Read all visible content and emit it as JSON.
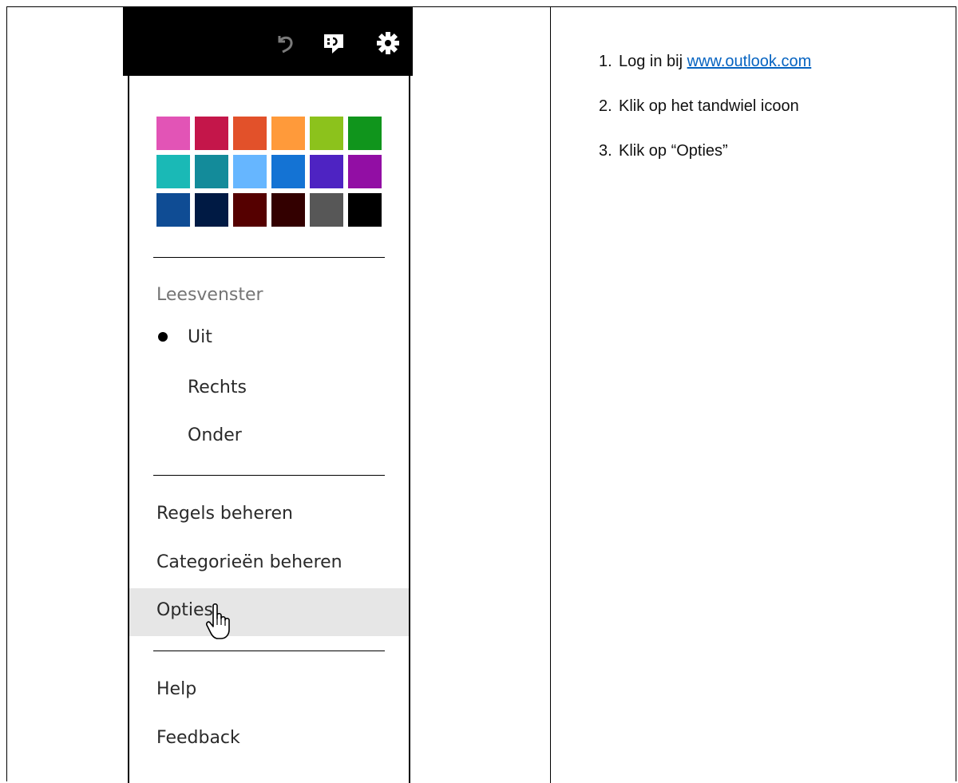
{
  "toolbar": {
    "icons": [
      "undo-icon",
      "feedback-chat-icon",
      "gear-icon"
    ]
  },
  "theme": {
    "colors": [
      "#e254b6",
      "#c4164a",
      "#e2512a",
      "#ff9a3a",
      "#8cc21c",
      "#10951c",
      "#1ab9b6",
      "#138b9a",
      "#66b6ff",
      "#1473d4",
      "#4e23c2",
      "#920ea4",
      "#0f4c94",
      "#001a44",
      "#550000",
      "#330000",
      "#575757",
      "#000000"
    ]
  },
  "menu": {
    "reading_pane_label": "Leesvenster",
    "reading_pane_options": [
      {
        "label": "Uit",
        "selected": true
      },
      {
        "label": "Rechts",
        "selected": false
      },
      {
        "label": "Onder",
        "selected": false
      }
    ],
    "manage_rules": "Regels beheren",
    "manage_categories": "Categorieën beheren",
    "options": "Opties",
    "help": "Help",
    "feedback": "Feedback"
  },
  "instructions": {
    "step1_number": "1.",
    "step1_prefix": "Log in bij ",
    "step1_link": "www.outlook.com",
    "step2_number": "2.",
    "step2_text": "Klik op het tandwiel icoon",
    "step3_number": "3.",
    "step3_text": "Klik op “Opties”"
  }
}
